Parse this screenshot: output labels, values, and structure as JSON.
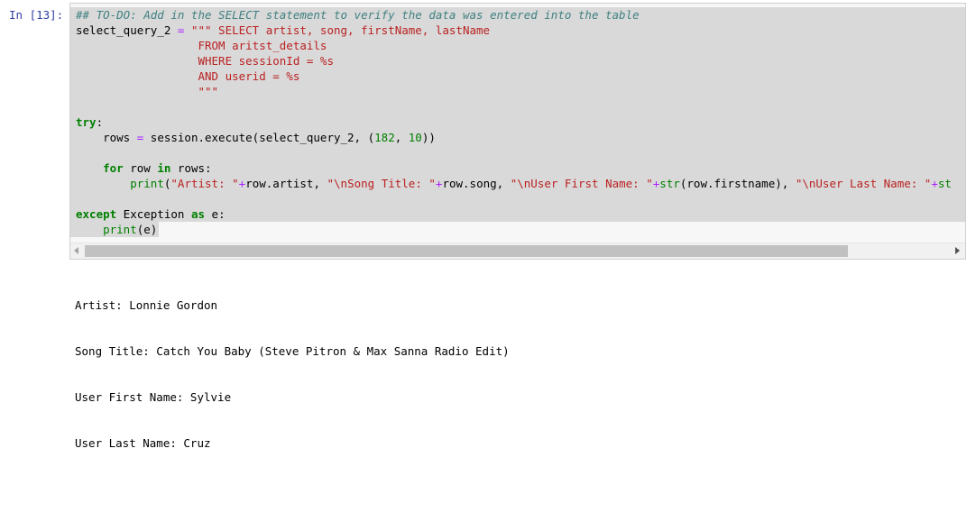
{
  "cell": {
    "prompt": "In [13]:",
    "code": {
      "comment": "## TO-DO: Add in the SELECT statement to verify the data was entered into the table",
      "l2_var": "select_query_2",
      "l2_eq": " = ",
      "l2_str": "\"\"\" SELECT artist, song, firstName, lastName",
      "l3_str": "                  FROM aritst_details",
      "l4_str": "                  WHERE sessionId = %s",
      "l5_str": "                  AND userid = %s",
      "l6_str": "                  \"\"\"",
      "try_kw": "try",
      "try_colon": ":",
      "rows_a": "    rows ",
      "rows_eq": "=",
      "rows_b": " session.execute(select_query_2, (",
      "rows_n1": "182",
      "rows_c": ", ",
      "rows_n2": "10",
      "rows_d": "))",
      "for_indent": "    ",
      "for_kw": "for",
      "for_a": " row ",
      "for_in": "in",
      "for_b": " rows:",
      "print_indent": "        ",
      "print_fn": "print",
      "print_a": "(",
      "s_artist": "\"Artist: \"",
      "plus1": "+",
      "print_b": "row.artist, ",
      "s_song": "\"\\nSong Title: \"",
      "plus2": "+",
      "print_c": "row.song, ",
      "s_first": "\"\\nUser First Name: \"",
      "plus3": "+",
      "str1": "str",
      "print_d": "(row.firstname), ",
      "s_last": "\"\\nUser Last Name: \"",
      "plus4": "+",
      "print_e": "st",
      "except_kw": "except",
      "except_a": " Exception ",
      "as_kw": "as",
      "except_b": " e:",
      "print2_indent": "    ",
      "print2_fn": "print",
      "print2_a": "(e)"
    }
  },
  "output": {
    "lines": [
      "Artist: Lonnie Gordon",
      "Song Title: Catch You Baby (Steve Pitron & Max Sanna Radio Edit)",
      "User First Name: Sylvie",
      "User Last Name: Cruz"
    ]
  }
}
